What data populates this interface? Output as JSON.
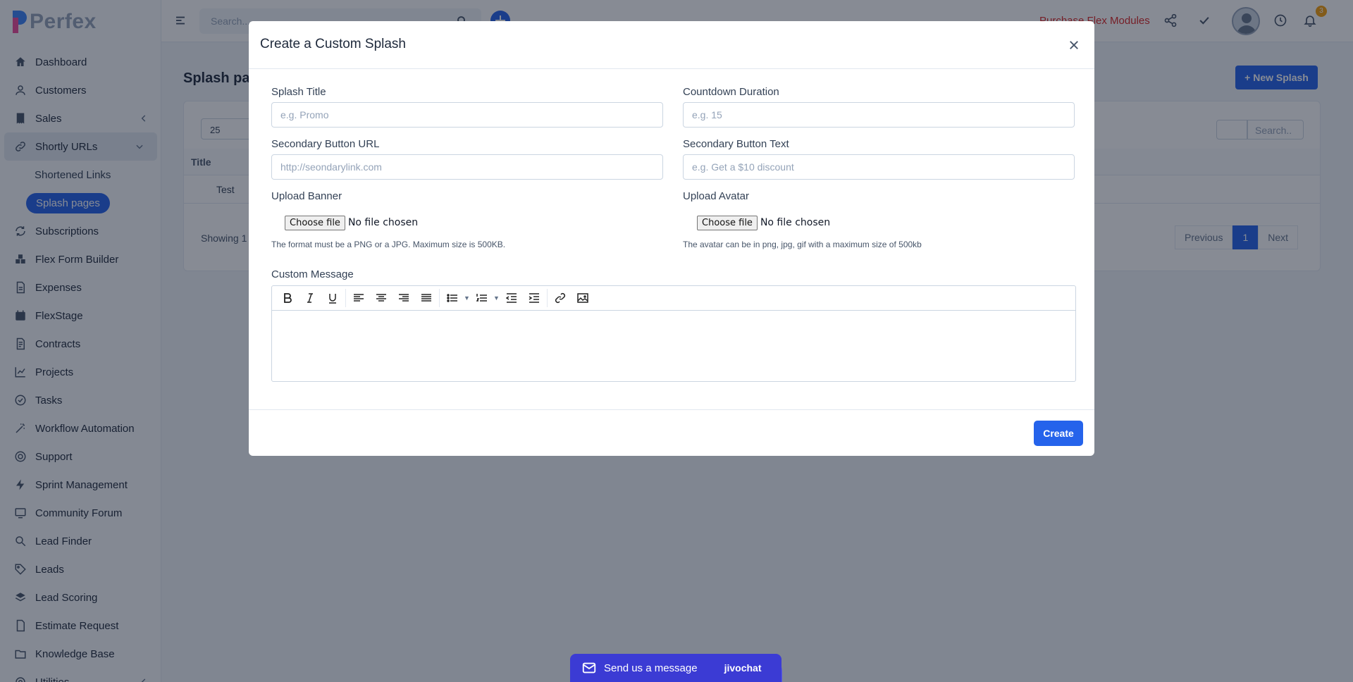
{
  "app": {
    "logo_text": "Perfex"
  },
  "sidebar": {
    "items": [
      {
        "label": "Dashboard",
        "icon": "home-icon"
      },
      {
        "label": "Customers",
        "icon": "user-icon"
      },
      {
        "label": "Sales",
        "icon": "receipt-icon"
      },
      {
        "label": "Shortly URLs",
        "icon": "link-icon"
      },
      {
        "label": "Subscriptions",
        "icon": "refresh-icon"
      },
      {
        "label": "Flex Form Builder",
        "icon": "cubes-icon"
      },
      {
        "label": "Expenses",
        "icon": "document-icon"
      },
      {
        "label": "FlexStage",
        "icon": "calendar-icon"
      },
      {
        "label": "Contracts",
        "icon": "contract-icon"
      },
      {
        "label": "Projects",
        "icon": "chart-icon"
      },
      {
        "label": "Tasks",
        "icon": "check-circle-icon"
      },
      {
        "label": "Workflow Automation",
        "icon": "wand-icon"
      },
      {
        "label": "Support",
        "icon": "lifebuoy-icon"
      },
      {
        "label": "Sprint Management",
        "icon": "bolt-icon"
      },
      {
        "label": "Community Forum",
        "icon": "monitor-icon"
      },
      {
        "label": "Lead Finder",
        "icon": "search-icon"
      },
      {
        "label": "Leads",
        "icon": "tag-icon"
      },
      {
        "label": "Lead Scoring",
        "icon": "layers-icon"
      },
      {
        "label": "Estimate Request",
        "icon": "file-icon"
      },
      {
        "label": "Knowledge Base",
        "icon": "folder-icon"
      },
      {
        "label": "Utilities",
        "icon": "gears-icon"
      }
    ],
    "sub_items": [
      {
        "label": "Shortened Links"
      },
      {
        "label": "Splash pages"
      }
    ]
  },
  "header": {
    "search_placeholder": "Search...",
    "purchase_link": "Purchase Flex Modules",
    "notification_count": "3"
  },
  "page": {
    "title": "Splash pages",
    "new_button": "New Splash",
    "page_length": "25",
    "table_search_placeholder": "Search..",
    "column_title": "Title",
    "rows": [
      {
        "title": "Test"
      }
    ],
    "showing": "Showing 1",
    "pager": {
      "previous": "Previous",
      "current": "1",
      "next": "Next"
    }
  },
  "modal": {
    "title": "Create a Custom Splash",
    "splash_title": {
      "label": "Splash Title",
      "placeholder": "e.g. Promo"
    },
    "countdown": {
      "label": "Countdown Duration",
      "placeholder": "e.g. 15"
    },
    "secondary_url": {
      "label": "Secondary Button URL",
      "placeholder": "http://seondarylink.com"
    },
    "secondary_text": {
      "label": "Secondary Button Text",
      "placeholder": "e.g. Get a $10 discount"
    },
    "upload_banner": {
      "label": "Upload Banner",
      "button": "Choose file",
      "status": "No file chosen",
      "help": "The format must be a PNG or a JPG. Maximum size is 500KB."
    },
    "upload_avatar": {
      "label": "Upload Avatar",
      "button": "Choose file",
      "status": "No file chosen",
      "help": "The avatar can be in png, jpg, gif with a maximum size of 500kb"
    },
    "message_label": "Custom Message",
    "create_button": "Create"
  },
  "chat": {
    "label": "Send us a message",
    "brand": "jivochat"
  },
  "colors": {
    "primary": "#2563eb",
    "danger": "#dc2626",
    "chat": "#3b3bd4"
  }
}
